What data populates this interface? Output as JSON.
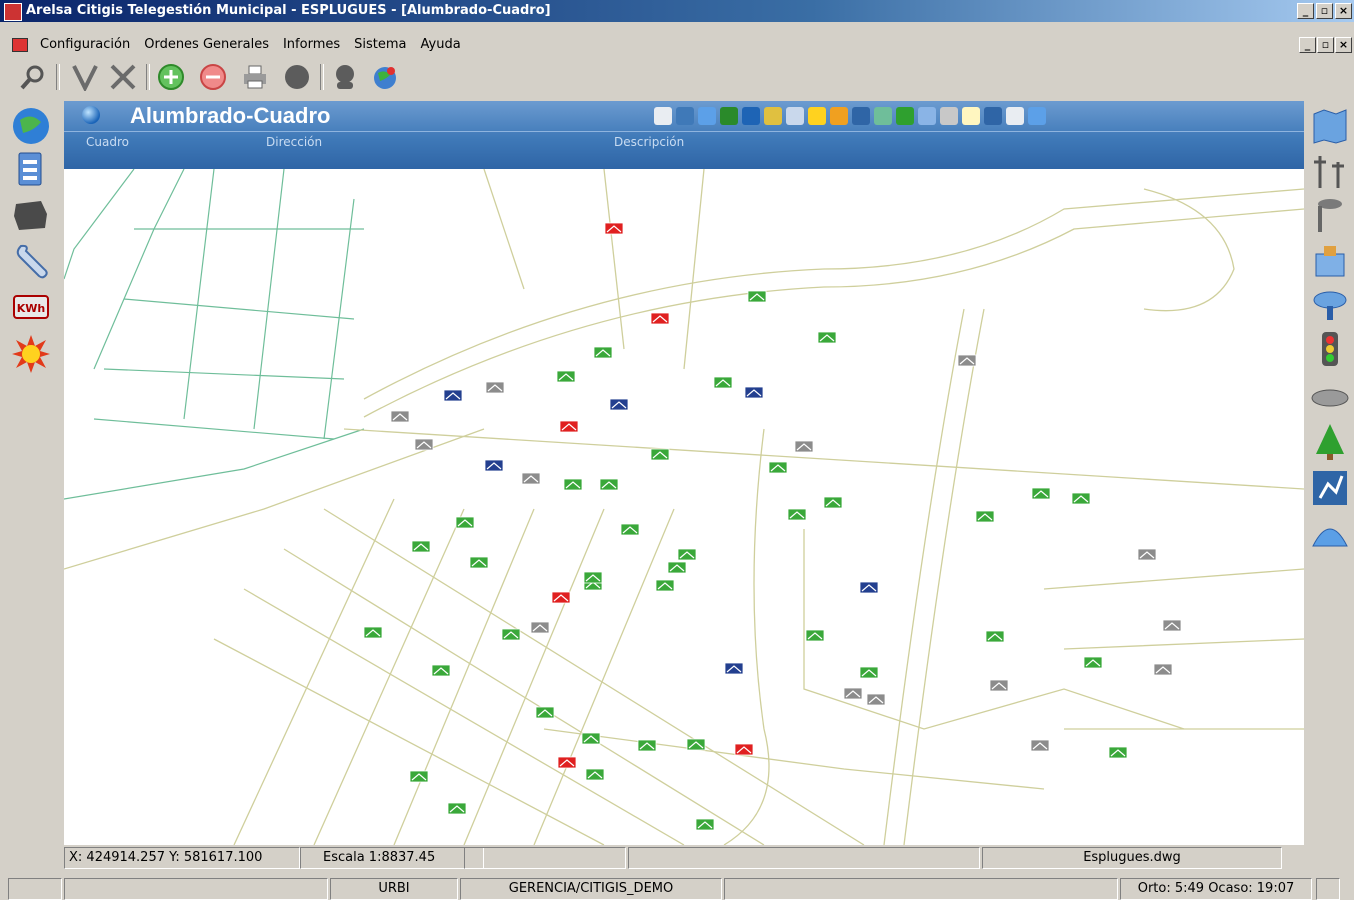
{
  "window": {
    "title": "Arelsa Citigis Telegestión Municipal - ESPLUGUES - [Alumbrado-Cuadro]",
    "min_label": "_",
    "restore_label": "▫",
    "close_label": "×"
  },
  "menu": {
    "items": [
      "Configuración",
      "Ordenes Generales",
      "Informes",
      "Sistema",
      "Ayuda"
    ]
  },
  "panel": {
    "title": "Alumbrado-Cuadro",
    "columns": [
      "Cuadro",
      "Dirección",
      "Descripción"
    ]
  },
  "status": {
    "coords": "X: 424914.257  Y: 581617.100",
    "scale": "Escala 1:8837.45",
    "file": "Esplugues.dwg",
    "user_mode": "URBI",
    "db": "GERENCIA/CITIGIS_DEMO",
    "sun": "Orto: 5:49  Ocaso: 19:07"
  },
  "map": {
    "markers": [
      {
        "status": "green",
        "count": 42
      },
      {
        "status": "gray",
        "count": 16
      },
      {
        "status": "red",
        "count": 7
      },
      {
        "status": "blue",
        "count": 6
      }
    ]
  },
  "colors": {
    "green": "#3aa83a",
    "gray": "#8c8c8c",
    "red": "#e02020",
    "blue": "#233f8f",
    "street": "#cfcf9c",
    "water": "#6fbe9a"
  },
  "icons": {
    "toolbar": [
      "search-icon",
      "check-icon",
      "cancel-icon",
      "add-icon",
      "remove-icon",
      "print-icon",
      "dot-icon",
      "user-icon",
      "globe-icon"
    ],
    "left": [
      "globe-icon",
      "document-icon",
      "map-region-icon",
      "wrench-icon",
      "kwh-icon",
      "sun-icon"
    ],
    "right": [
      "map-icon",
      "powerline-icon",
      "streetlight-icon",
      "building-icon",
      "lamp-icon",
      "traffic-light-icon",
      "manhole-icon",
      "tree-icon",
      "route-icon",
      "dome-icon"
    ]
  }
}
